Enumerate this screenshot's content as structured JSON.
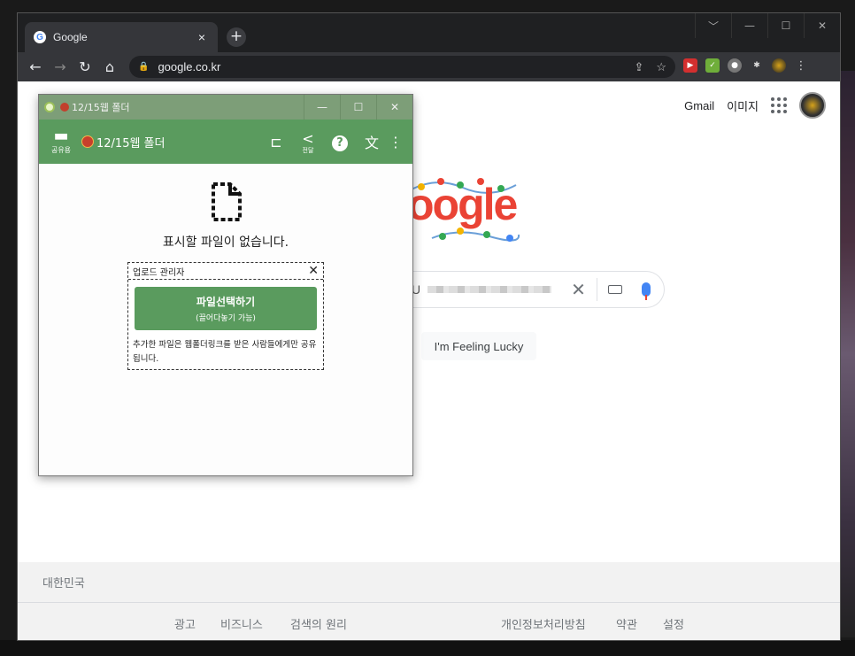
{
  "browser": {
    "tab_title": "Google",
    "favicon": "G",
    "tab_close": "×",
    "new_tab": "+",
    "url": "google.co.kr",
    "window_controls": [
      "﹀",
      "—",
      "☐",
      "✕"
    ]
  },
  "google": {
    "gmail": "Gmail",
    "images": "이미지",
    "doodle_text": "oogle",
    "search_prefix": "U",
    "clear": "✕",
    "lucky": "I'm Feeling Lucky",
    "footer": {
      "country": "대한민국",
      "ad": "광고",
      "business": "비즈니스",
      "search_principle": "검색의 원리",
      "privacy": "개인정보처리방침",
      "terms": "약관",
      "settings": "설정"
    }
  },
  "app": {
    "window_title": "12/15웹 폴더",
    "window_controls": [
      "—",
      "☐",
      "✕"
    ],
    "folder_label": "공유용",
    "header_title": "12/15웹 폴더",
    "share_label": "전달",
    "help": "?",
    "more": "⋮",
    "empty_message": "표시할 파일이 없습니다.",
    "upload": {
      "title": "업로드 관리자",
      "close": "✕",
      "button_line1": "파일선택하기",
      "button_line2": "(끌어다놓기 가능)",
      "note": "추가한 파일은 웹폴더링크를 받은 사람들에게만 공유됩니다."
    }
  },
  "colors": {
    "app_green": "#5a9b5e",
    "titlebar_green": "#7d9e78"
  }
}
